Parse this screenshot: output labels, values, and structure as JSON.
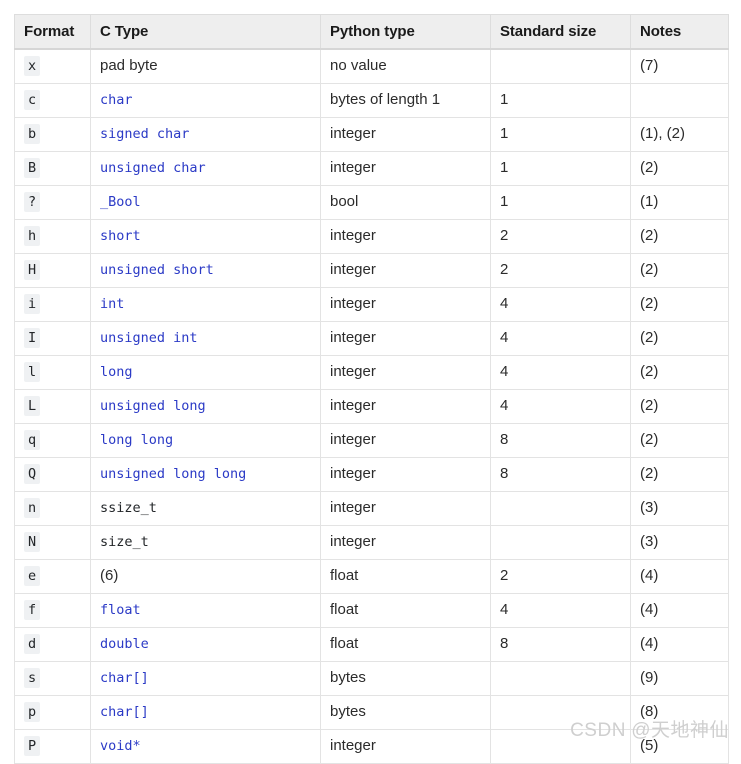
{
  "table": {
    "title": "Struct format characters table",
    "columns": [
      {
        "key": "format",
        "label": "Format"
      },
      {
        "key": "ctype",
        "label": "C Type"
      },
      {
        "key": "pytype",
        "label": "Python type"
      },
      {
        "key": "stdsize",
        "label": "Standard size"
      },
      {
        "key": "notes",
        "label": "Notes"
      }
    ],
    "rows": [
      {
        "format": "x",
        "ctype": "pad byte",
        "ctype_style": "plain",
        "pytype": "no value",
        "stdsize": "",
        "notes": "(7)"
      },
      {
        "format": "c",
        "ctype": "char",
        "ctype_style": "code-link",
        "pytype": "bytes of length 1",
        "stdsize": "1",
        "notes": ""
      },
      {
        "format": "b",
        "ctype": "signed char",
        "ctype_style": "code-link",
        "pytype": "integer",
        "stdsize": "1",
        "notes": "(1), (2)"
      },
      {
        "format": "B",
        "ctype": "unsigned char",
        "ctype_style": "code-link",
        "pytype": "integer",
        "stdsize": "1",
        "notes": "(2)"
      },
      {
        "format": "?",
        "ctype": "_Bool",
        "ctype_style": "code-link",
        "pytype": "bool",
        "stdsize": "1",
        "notes": "(1)"
      },
      {
        "format": "h",
        "ctype": "short",
        "ctype_style": "code-link",
        "pytype": "integer",
        "stdsize": "2",
        "notes": "(2)"
      },
      {
        "format": "H",
        "ctype": "unsigned short",
        "ctype_style": "code-link",
        "pytype": "integer",
        "stdsize": "2",
        "notes": "(2)"
      },
      {
        "format": "i",
        "ctype": "int",
        "ctype_style": "code-link",
        "pytype": "integer",
        "stdsize": "4",
        "notes": "(2)"
      },
      {
        "format": "I",
        "ctype": "unsigned int",
        "ctype_style": "code-link",
        "pytype": "integer",
        "stdsize": "4",
        "notes": "(2)"
      },
      {
        "format": "l",
        "ctype": "long",
        "ctype_style": "code-link",
        "pytype": "integer",
        "stdsize": "4",
        "notes": "(2)"
      },
      {
        "format": "L",
        "ctype": "unsigned long",
        "ctype_style": "code-link",
        "pytype": "integer",
        "stdsize": "4",
        "notes": "(2)"
      },
      {
        "format": "q",
        "ctype": "long long",
        "ctype_style": "code-link",
        "pytype": "integer",
        "stdsize": "8",
        "notes": "(2)"
      },
      {
        "format": "Q",
        "ctype": "unsigned long long",
        "ctype_style": "code-link",
        "pytype": "integer",
        "stdsize": "8",
        "notes": "(2)"
      },
      {
        "format": "n",
        "ctype": "ssize_t",
        "ctype_style": "code-plain",
        "pytype": "integer",
        "stdsize": "",
        "notes": "(3)"
      },
      {
        "format": "N",
        "ctype": "size_t",
        "ctype_style": "code-plain",
        "pytype": "integer",
        "stdsize": "",
        "notes": "(3)"
      },
      {
        "format": "e",
        "ctype": "(6)",
        "ctype_style": "plain",
        "pytype": "float",
        "stdsize": "2",
        "notes": "(4)"
      },
      {
        "format": "f",
        "ctype": "float",
        "ctype_style": "code-link",
        "pytype": "float",
        "stdsize": "4",
        "notes": "(4)"
      },
      {
        "format": "d",
        "ctype": "double",
        "ctype_style": "code-link",
        "pytype": "float",
        "stdsize": "8",
        "notes": "(4)"
      },
      {
        "format": "s",
        "ctype": "char[]",
        "ctype_style": "code-link",
        "pytype": "bytes",
        "stdsize": "",
        "notes": "(9)"
      },
      {
        "format": "p",
        "ctype": "char[]",
        "ctype_style": "code-link",
        "pytype": "bytes",
        "stdsize": "",
        "notes": "(8)"
      },
      {
        "format": "P",
        "ctype": "void*",
        "ctype_style": "code-link",
        "pytype": "integer",
        "stdsize": "",
        "notes": "(5)"
      }
    ]
  },
  "watermark": {
    "brand": "CSDN",
    "user": "@天地神仙"
  },
  "colors": {
    "header_bg": "#eeeeee",
    "border": "#e3e3e3",
    "code_link": "#2b3ac6",
    "code_chip_bg": "#eff1f3",
    "text": "#2b2b2b",
    "watermark": "#cfcfcf"
  }
}
